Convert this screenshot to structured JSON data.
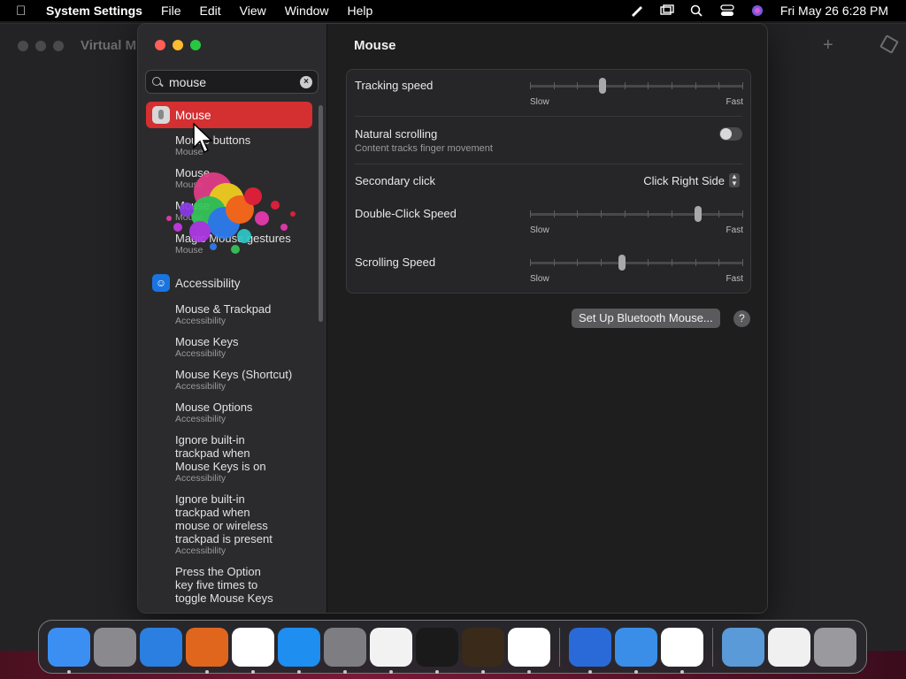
{
  "menubar": {
    "app_name": "System Settings",
    "menus": [
      "File",
      "Edit",
      "View",
      "Window",
      "Help"
    ],
    "clock": "Fri May 26  6:28 PM"
  },
  "background_window": {
    "title": "Virtual M"
  },
  "search": {
    "value": "mouse"
  },
  "sidebar": {
    "selected": "Mouse",
    "mouse_subitems": [
      {
        "title": "Mouse buttons",
        "subtitle": "Mouse"
      },
      {
        "title": "Mouse",
        "subtitle": "Mouse"
      },
      {
        "title": "Mouse",
        "subtitle": "Mouse"
      },
      {
        "title": "Magic Mouse gestures",
        "subtitle": "Mouse"
      }
    ],
    "category": "Accessibility",
    "accessibility_items": [
      {
        "title": "Mouse & Trackpad",
        "subtitle": "Accessibility"
      },
      {
        "title": "Mouse Keys",
        "subtitle": "Accessibility"
      },
      {
        "title": "Mouse Keys (Shortcut)",
        "subtitle": "Accessibility"
      },
      {
        "title": "Mouse Options",
        "subtitle": "Accessibility"
      },
      {
        "title": "Ignore built-in trackpad when Mouse Keys is on",
        "subtitle": "Accessibility"
      },
      {
        "title": "Ignore built-in trackpad when mouse or wireless trackpad is present",
        "subtitle": "Accessibility"
      },
      {
        "title": "Press the Option key five times to toggle Mouse Keys",
        "subtitle": ""
      }
    ]
  },
  "content": {
    "title": "Mouse",
    "tracking_speed": {
      "label": "Tracking speed",
      "value": 0.34,
      "slow": "Slow",
      "fast": "Fast"
    },
    "natural_scrolling": {
      "label": "Natural scrolling",
      "sub": "Content tracks finger movement",
      "on": false
    },
    "secondary_click": {
      "label": "Secondary click",
      "value": "Click Right Side"
    },
    "double_click_speed": {
      "label": "Double-Click Speed",
      "value": 0.79,
      "slow": "Slow",
      "fast": "Fast"
    },
    "scrolling_speed": {
      "label": "Scrolling Speed",
      "value": 0.43,
      "slow": "Slow",
      "fast": "Fast"
    },
    "bt_button": "Set Up Bluetooth Mouse...",
    "help": "?"
  },
  "dock": {
    "apps": [
      {
        "name": "finder-icon",
        "color": "#3b8ff3",
        "running": true
      },
      {
        "name": "launchpad-icon",
        "color": "#8a8a8e",
        "running": false
      },
      {
        "name": "safari-icon",
        "color": "#2b7fe0",
        "running": false
      },
      {
        "name": "firefox-icon",
        "color": "#e0661e",
        "running": true
      },
      {
        "name": "chrome-icon",
        "color": "#ffffff",
        "running": true
      },
      {
        "name": "app-store-icon",
        "color": "#1e8ef0",
        "running": true
      },
      {
        "name": "system-settings-icon",
        "color": "#7e7e82",
        "running": true
      },
      {
        "name": "textedit-icon",
        "color": "#f2f2f2",
        "running": true
      },
      {
        "name": "terminal-icon",
        "color": "#1a1a1a",
        "running": true
      },
      {
        "name": "garageband-icon",
        "color": "#3a2a1a",
        "running": true
      },
      {
        "name": "vscode-icon",
        "color": "#ffffff",
        "running": true
      }
    ],
    "apps2": [
      {
        "name": "virtual-machine-icon",
        "color": "#2a6ad8",
        "running": true
      },
      {
        "name": "weather-icon",
        "color": "#3a8ee8",
        "running": true
      },
      {
        "name": "utility-icon",
        "color": "#ffffff",
        "running": true
      }
    ],
    "docs": [
      {
        "name": "screenshot-folder-icon",
        "color": "#5a9ad8"
      },
      {
        "name": "document-thumbnail-icon",
        "color": "#f0f0f0"
      },
      {
        "name": "trash-icon",
        "color": "#9a9a9e"
      }
    ]
  }
}
